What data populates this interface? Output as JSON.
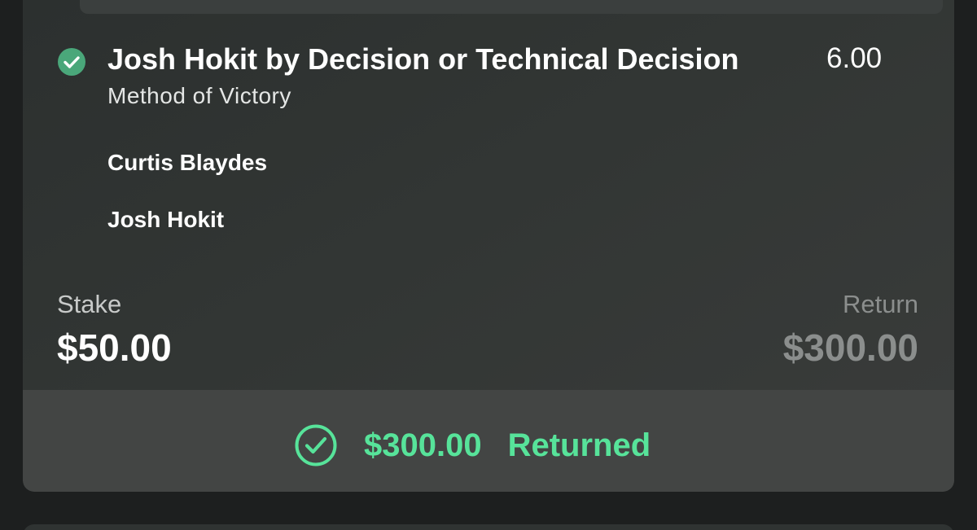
{
  "bet": {
    "selection": "Josh Hokit by Decision or Technical Decision",
    "odds": "6.00",
    "market": "Method of Victory",
    "fighters": [
      "Curtis Blaydes",
      "Josh Hokit"
    ]
  },
  "stake": {
    "label": "Stake",
    "value": "$50.00"
  },
  "return": {
    "label": "Return",
    "value": "$300.00"
  },
  "result": {
    "amount": "$300.00",
    "status": "Returned",
    "accent": "#57e39a"
  },
  "icons": {
    "selection_status": "check-circle-icon",
    "result_status": "check-circle-outline-icon"
  },
  "colors": {
    "win_green": "#4aa77a",
    "returned_green": "#57e39a"
  }
}
